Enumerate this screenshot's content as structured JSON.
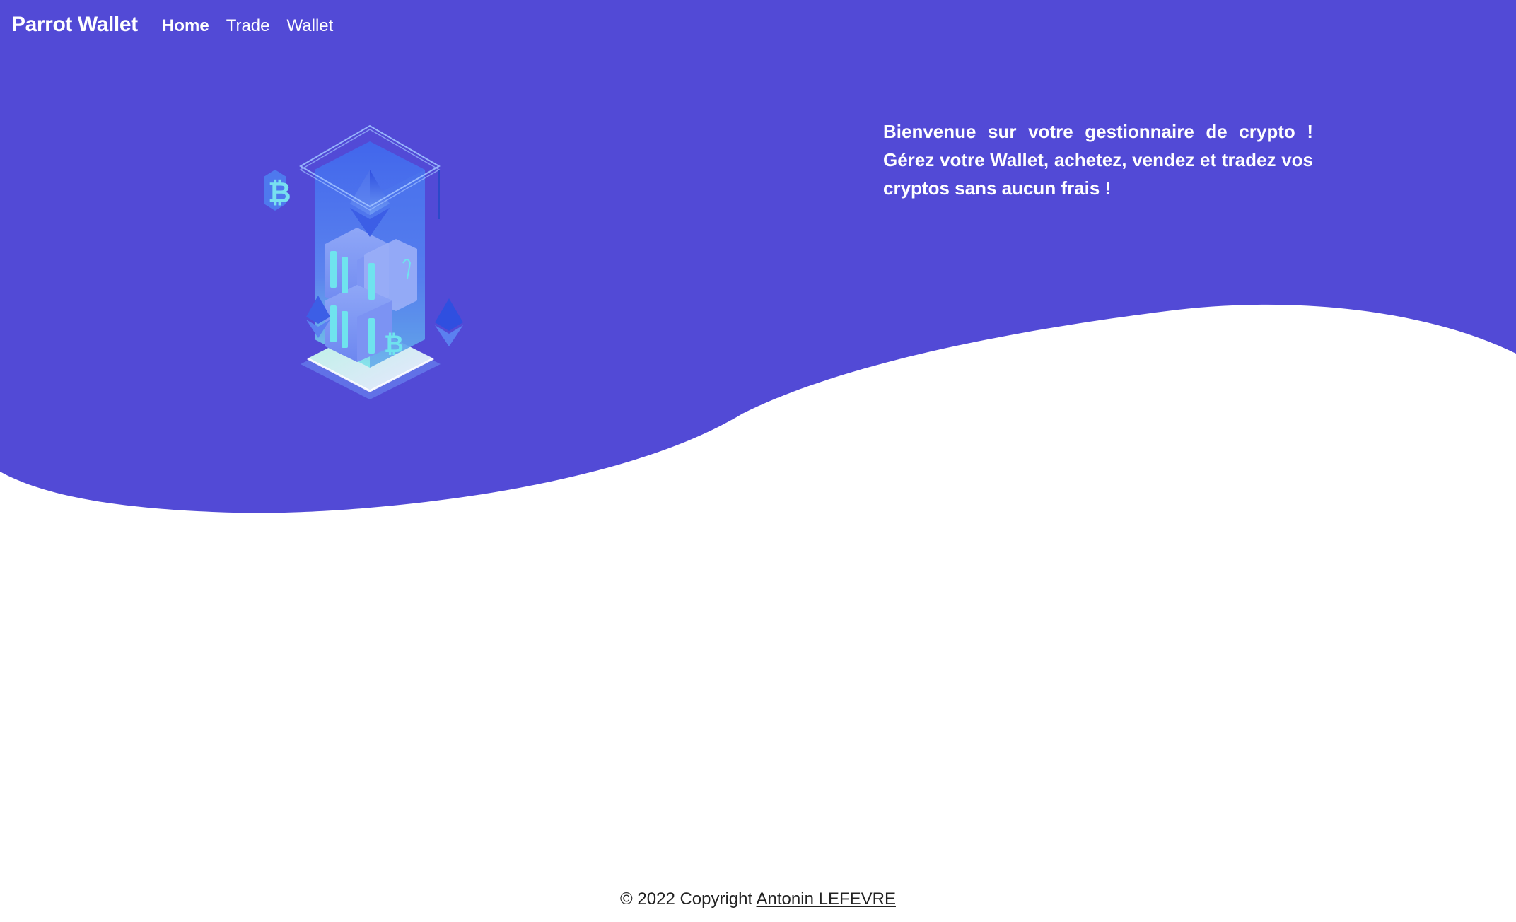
{
  "app": {
    "brand": "Parrot Wallet"
  },
  "nav": {
    "items": [
      {
        "label": "Home",
        "active": true
      },
      {
        "label": "Trade",
        "active": false
      },
      {
        "label": "Wallet",
        "active": false
      }
    ]
  },
  "hero": {
    "welcome_text": "Bienvenue sur votre gestionnaire de crypto ! Gérez votre Wallet, achetez, vendez et tradez vos cryptos sans aucun frais !",
    "illustration_icon": "crypto-isometric-illustration"
  },
  "footer": {
    "copyright_prefix": "© 2022 Copyright ",
    "author_link": "Antonin LEFEVRE"
  },
  "colors": {
    "primary": "#524AD6",
    "background": "#FFFFFF",
    "nav_text": "#FFFFFF",
    "footer_text": "#222222"
  }
}
